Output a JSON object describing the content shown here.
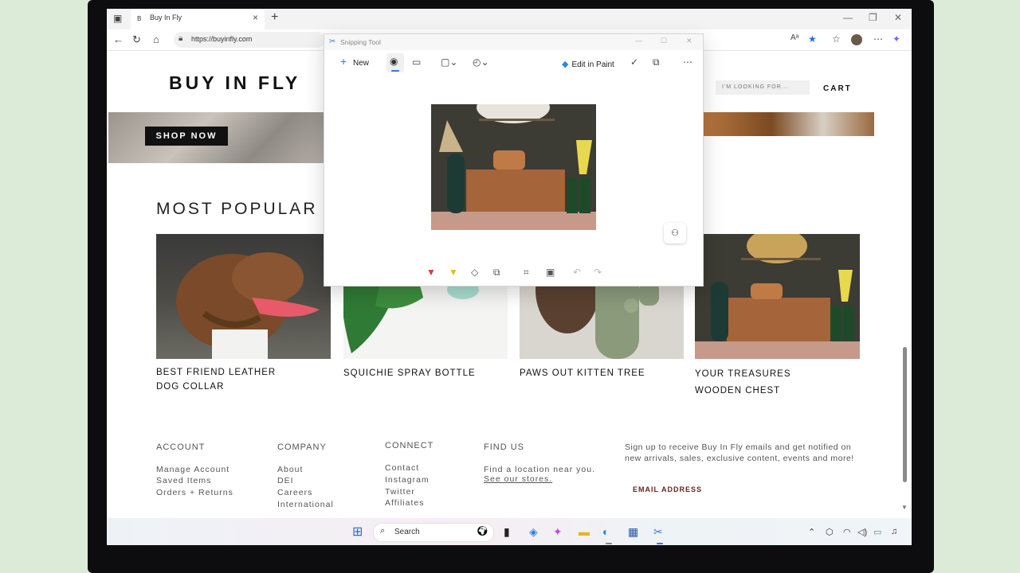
{
  "browser": {
    "tab_title": "Buy In Fly",
    "tab_favicon": "B",
    "url": "https://buyinfly.com"
  },
  "site": {
    "logo": "BUY IN FLY",
    "search_placeholder": "I'M LOOKING FOR...",
    "cart_label": "CART",
    "shop_now": "SHOP NOW",
    "section_title": "MOST POPULAR",
    "products": [
      {
        "line1": "BEST FRIEND LEATHER",
        "line2": "DOG COLLAR"
      },
      {
        "line1": "SQUICHIE SPRAY BOTTLE",
        "line2": ""
      },
      {
        "line1": "PAWS OUT KITTEN TREE",
        "line2": ""
      },
      {
        "line1": "YOUR TREASURES",
        "line2": "WOODEN CHEST"
      }
    ]
  },
  "footer": {
    "account": {
      "title": "ACCOUNT",
      "links": [
        "Manage Account",
        "Saved Items",
        "Orders + Returns"
      ]
    },
    "company": {
      "title": "COMPANY",
      "links": [
        "About",
        "DEI",
        "Careers",
        "International"
      ]
    },
    "connect": {
      "title": "CONNECT",
      "links": [
        "Contact",
        "Instagram",
        "Twitter",
        "Affiliates"
      ]
    },
    "find_us": {
      "title": "FIND US",
      "text": "Find a location near you.",
      "link": "See our stores."
    },
    "signup_text": "Sign up to receive Buy In Fly emails and get notified on new arrivals, sales, exclusive content, events and more!",
    "email_label": "EMAIL ADDRESS"
  },
  "snipping_tool": {
    "title": "Snipping Tool",
    "new_label": "New",
    "edit_in_paint": "Edit in Paint"
  },
  "taskbar": {
    "search_label": "Search"
  },
  "colors": {
    "accent": "#3a7bd5",
    "email_label": "#6b1f1f"
  }
}
